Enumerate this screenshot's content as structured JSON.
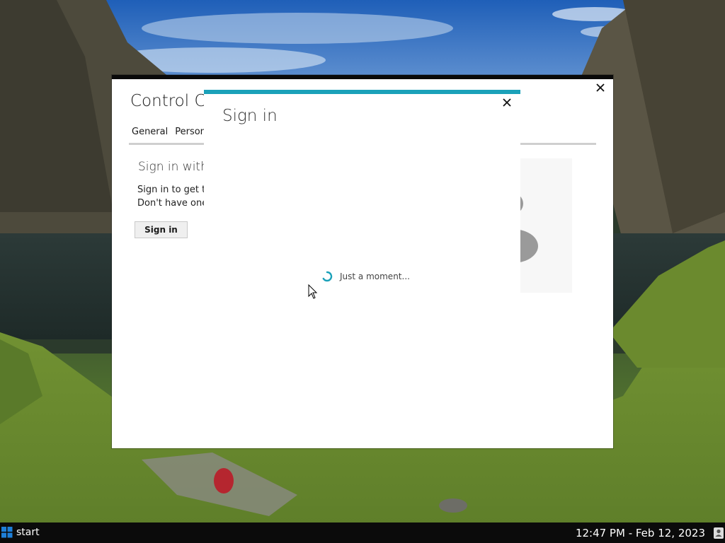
{
  "control_center": {
    "title": "Control Ce",
    "tabs": [
      "General",
      "Persona"
    ],
    "section_title": "Sign in with",
    "desc_line1": "Sign in to get th",
    "desc_line2": "Don't have one?",
    "signin_button": "Sign in"
  },
  "signin_dialog": {
    "title": "Sign in",
    "loading_text": "Just a moment...",
    "accent_color": "#1ba1b9"
  },
  "taskbar": {
    "start_label": "start",
    "clock": "12:47 PM - Feb 12, 2023"
  },
  "icons": {
    "close": "close-icon",
    "spinner": "spinner-icon",
    "start": "windows-logo-icon",
    "user": "user-icon"
  }
}
